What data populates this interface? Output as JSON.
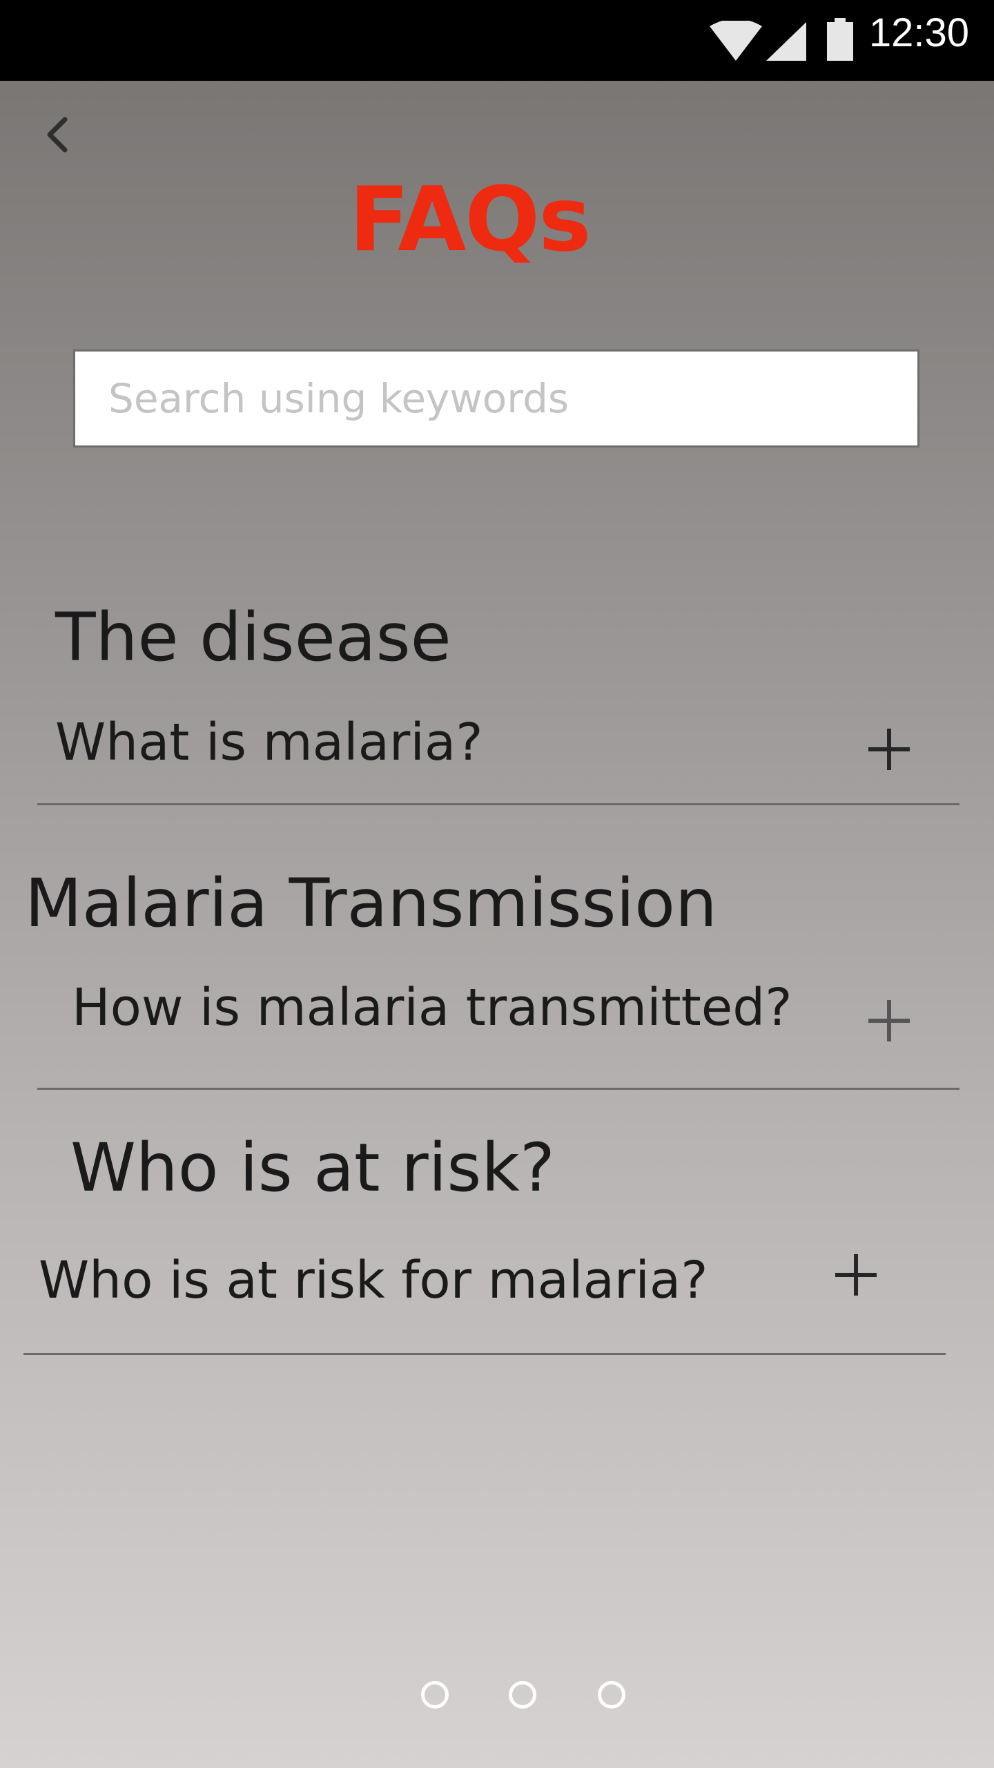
{
  "status_bar": {
    "time": "12:30",
    "icons": [
      "wifi-icon",
      "cellular-signal-icon",
      "battery-icon"
    ]
  },
  "header": {
    "back_icon": "chevron-left-icon",
    "title": "FAQs",
    "title_color": "#ee2a10"
  },
  "search": {
    "placeholder": "Search using keywords",
    "value": ""
  },
  "sections": [
    {
      "heading": "The disease",
      "question": "What is malaria?",
      "expand_icon": "plus-icon"
    },
    {
      "heading": "Malaria Transmission",
      "question": "How is malaria transmitted?",
      "expand_icon": "plus-icon"
    },
    {
      "heading": "Who is at risk?",
      "question": "Who is at risk for malaria?",
      "expand_icon": "plus-icon"
    }
  ],
  "pagination": {
    "count": 3,
    "icon": "circle-outline-icon"
  }
}
